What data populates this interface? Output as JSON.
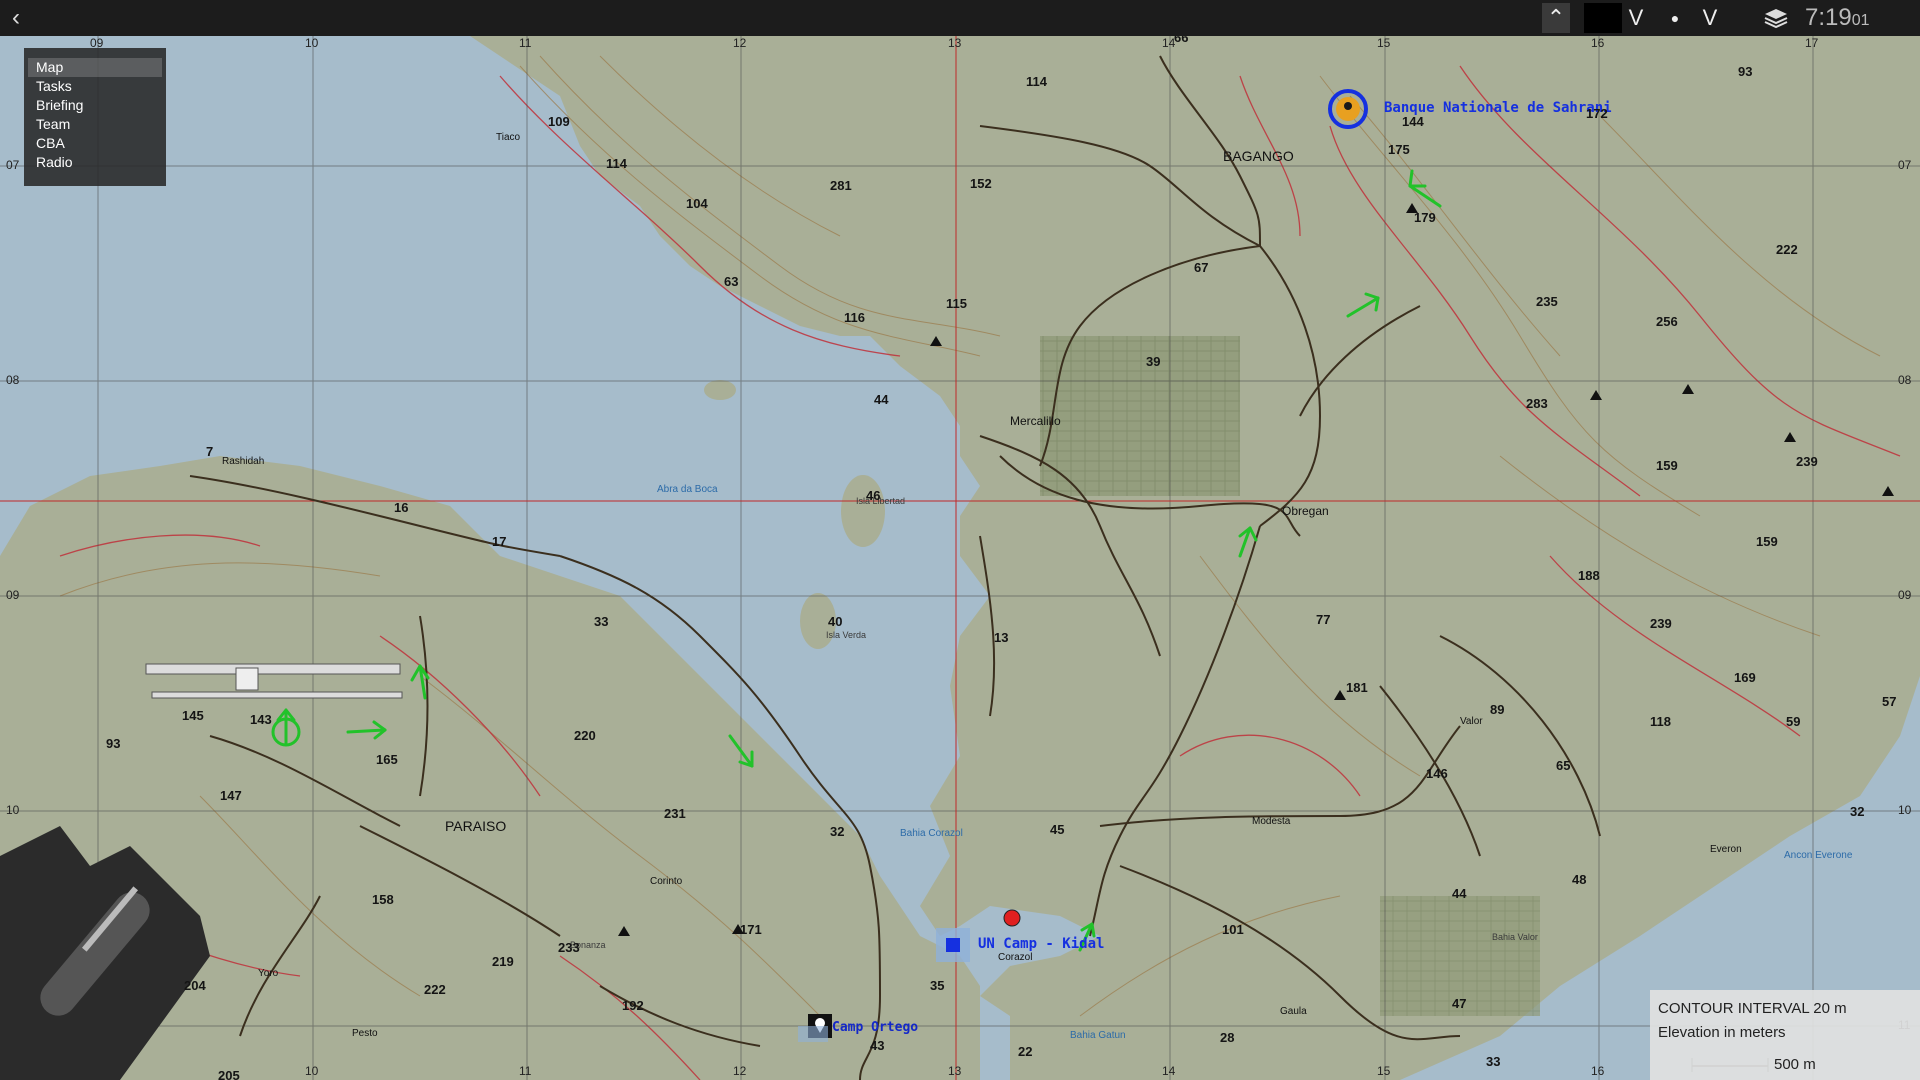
{
  "topbar": {
    "back_icon": "chevron-left-icon",
    "up_btn": "⌃",
    "dropdown1": "V",
    "dot": "●",
    "dropdown2": "V",
    "layers_icon": "layers-icon",
    "time_main": "7:19",
    "time_sec": "01"
  },
  "menu": {
    "items": [
      {
        "label": "Map"
      },
      {
        "label": "Tasks"
      },
      {
        "label": "Briefing"
      },
      {
        "label": "Team"
      },
      {
        "label": "CBA"
      },
      {
        "label": "Radio"
      }
    ]
  },
  "grid": {
    "top": [
      "09",
      "10",
      "11",
      "12",
      "13",
      "14",
      "15",
      "16",
      "17"
    ],
    "bottom": [
      "10",
      "11",
      "12",
      "13",
      "14",
      "15",
      "16"
    ],
    "left": [
      "07",
      "08",
      "09",
      "10"
    ],
    "right": [
      "07",
      "08",
      "09",
      "10",
      "11"
    ]
  },
  "markers": {
    "bank": "Banque Nationale de Sahrani",
    "un_camp": "UN Camp - Kidal",
    "camp_ortego": "Camp Ortego"
  },
  "towns": {
    "bagango": "BAGANGO",
    "paraiso": "PARAISO",
    "mercalillo": "Mercalillo",
    "obregan": "Obregan",
    "rashidah": "Rashidah",
    "modesta": "Modesta",
    "everon": "Everon",
    "corazol": "Corazol",
    "gaula": "Gaula",
    "pesto": "Pesto",
    "yoro": "Yoro",
    "corinto": "Corinto",
    "tiaco": "Tiaco",
    "valor": "Valor",
    "bonanza": "Bonanza",
    "isla_libertad": "Isla Libertad",
    "isla_verda": "Isla Verda"
  },
  "water": {
    "abra_da_boca": "Abra da Boca",
    "bahia_corazol": "Bahia Corazol",
    "bahia_gatun": "Bahia Gatun",
    "ancon_everone": "Ancon Everone",
    "bahia_valor": "Bahia Valor"
  },
  "elevations": {
    "e66": "66",
    "e114a": "114",
    "e109": "109",
    "e114b": "114",
    "e104": "104",
    "e281": "281",
    "e152": "152",
    "e175": "175",
    "e144": "144",
    "e172": "172",
    "e93a": "93",
    "e179": "179",
    "e222a": "222",
    "e67": "67",
    "e63": "63",
    "e116": "116",
    "e115": "115",
    "e235": "235",
    "e256": "256",
    "e39": "39",
    "e44a": "44",
    "e283": "283",
    "e159a": "159",
    "e239a": "239",
    "e46": "46",
    "e7": "7",
    "e16": "16",
    "e17": "17",
    "e159b": "159",
    "e188": "188",
    "e33": "33",
    "e40": "40",
    "e13": "13",
    "e77": "77",
    "e239b": "239",
    "e145": "145",
    "e143": "143",
    "e93b": "93",
    "e220": "220",
    "e165": "165",
    "e147": "147",
    "e181": "181",
    "e169": "169",
    "e89": "89",
    "e118": "118",
    "e59": "59",
    "e57": "57",
    "e146": "146",
    "e65": "65",
    "e231": "231",
    "e32a": "32",
    "e45": "45",
    "e32b": "32",
    "e158": "158",
    "e48": "48",
    "e44b": "44",
    "e101": "101",
    "e171": "171",
    "e233": "233",
    "e219": "219",
    "e204": "204",
    "e222b": "222",
    "e35": "35",
    "e192": "192",
    "e47": "47",
    "e43": "43",
    "e22": "22",
    "e28": "28",
    "e33b": "33",
    "e205": "205"
  },
  "legend": {
    "title": "CONTOUR INTERVAL 20 m",
    "subtitle": "Elevation in meters",
    "scale": "500 m"
  },
  "colors": {
    "water": "#a6bccb",
    "land": "#a9af97",
    "contour_low": "#9b7a4a",
    "contour_high": "#c0303a",
    "road": "#3b2f1e",
    "marker_blue": "#1530e0",
    "waypoint_green": "#22c22a"
  }
}
